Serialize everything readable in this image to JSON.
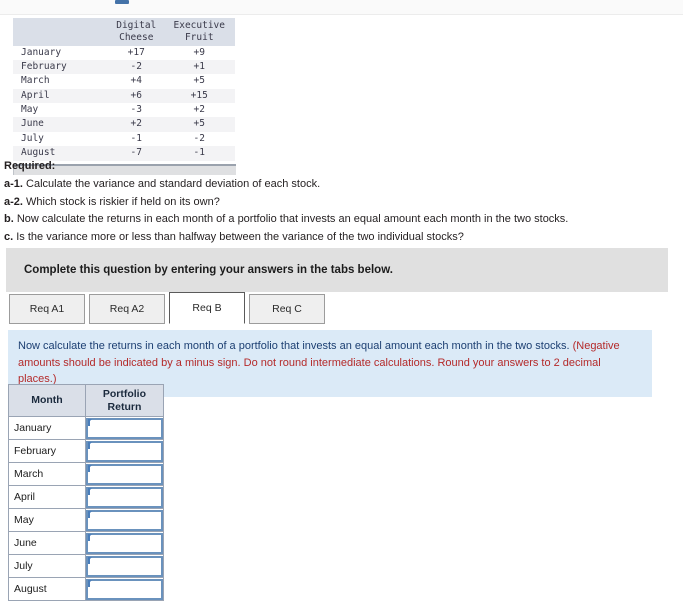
{
  "data_table": {
    "corner_header": "",
    "columns": [
      "Digital\nCheese",
      "Executive\nFruit"
    ],
    "rows": [
      {
        "month": "January",
        "digital_cheese": "+17",
        "executive_fruit": "+9"
      },
      {
        "month": "February",
        "digital_cheese": "-2",
        "executive_fruit": "+1"
      },
      {
        "month": "March",
        "digital_cheese": "+4",
        "executive_fruit": "+5"
      },
      {
        "month": "April",
        "digital_cheese": "+6",
        "executive_fruit": "+15"
      },
      {
        "month": "May",
        "digital_cheese": "-3",
        "executive_fruit": "+2"
      },
      {
        "month": "June",
        "digital_cheese": "+2",
        "executive_fruit": "+5"
      },
      {
        "month": "July",
        "digital_cheese": "-1",
        "executive_fruit": "-2"
      },
      {
        "month": "August",
        "digital_cheese": "-7",
        "executive_fruit": "-1"
      }
    ]
  },
  "required": {
    "title": "Required:",
    "items": [
      {
        "label": "a-1.",
        "text": " Calculate the variance and standard deviation of each stock."
      },
      {
        "label": "a-2.",
        "text": " Which stock is riskier if held on its own?"
      },
      {
        "label": "b.",
        "text": " Now calculate the returns in each month of a portfolio that invests an equal amount each month in the two stocks."
      },
      {
        "label": "c.",
        "text": " Is the variance more or less than halfway between the variance of the two individual stocks?"
      }
    ]
  },
  "complete_bar": {
    "text": "Complete this question by entering your answers in the tabs below."
  },
  "tabs": [
    {
      "label": "Req A1",
      "active": false
    },
    {
      "label": "Req A2",
      "active": false
    },
    {
      "label": "Req B",
      "active": true
    },
    {
      "label": "Req C",
      "active": false
    }
  ],
  "instruction_box": {
    "plain_text": "Now calculate the returns in each month of a portfolio that invests an equal amount each month in the two stocks. ",
    "red_text": "(Negative amounts should be indicated by a minus sign. Do not round intermediate calculations. Round your answers to 2 decimal places.)"
  },
  "answer_table": {
    "headers": {
      "month": "Month",
      "portfolio_return": "Portfolio\nReturn"
    },
    "rows": [
      {
        "month": "January",
        "value": ""
      },
      {
        "month": "February",
        "value": ""
      },
      {
        "month": "March",
        "value": ""
      },
      {
        "month": "April",
        "value": ""
      },
      {
        "month": "May",
        "value": ""
      },
      {
        "month": "June",
        "value": ""
      },
      {
        "month": "July",
        "value": ""
      },
      {
        "month": "August",
        "value": ""
      }
    ]
  },
  "colors": {
    "header_blue_grey": "#dadfe8",
    "info_box_bg": "#dbeaf7",
    "info_box_text": "#1c3f72",
    "info_box_red": "#b42a2a",
    "complete_bar_bg": "#e0e0e0",
    "input_border": "#6a92bd",
    "accent_blue": "#4a7ebb"
  }
}
